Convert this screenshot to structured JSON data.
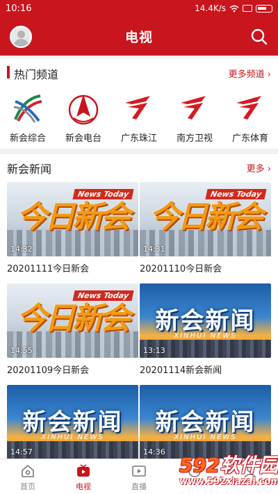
{
  "status_bar": {
    "time": "10:16",
    "network_speed": "14.4K/s"
  },
  "header": {
    "title": "电视",
    "avatar_icon": "avatar-icon",
    "search_icon": "search-icon"
  },
  "hot_channels": {
    "title": "热门频道",
    "more": "更多频道 ›",
    "items": [
      {
        "label": "新会综合",
        "icon": "xinhui-general-logo"
      },
      {
        "label": "新会电台",
        "icon": "xinhui-radio-logo"
      },
      {
        "label": "广东珠江",
        "icon": "guangdong-tv-logo"
      },
      {
        "label": "南方卫视",
        "icon": "guangdong-tv-logo"
      },
      {
        "label": "广东体育",
        "icon": "guangdong-tv-logo"
      }
    ]
  },
  "news": {
    "title": "新会新闻",
    "more": "更多 ›",
    "items": [
      {
        "title": "20201111今日新会",
        "duration": "14:32",
        "thumb": "today",
        "thumb_text": "今日新会",
        "thumb_tag": "News Today"
      },
      {
        "title": "20201110今日新会",
        "duration": "14:31",
        "thumb": "today",
        "thumb_text": "今日新会",
        "thumb_tag": "News Today"
      },
      {
        "title": "20201109今日新会",
        "duration": "14:55",
        "thumb": "today",
        "thumb_text": "今日新会",
        "thumb_tag": "News Today"
      },
      {
        "title": "20201114新会新闻",
        "duration": "13:13",
        "thumb": "xinhui",
        "thumb_text": "新会新闻",
        "thumb_sub": "XINHUI NEWS"
      },
      {
        "title": "",
        "duration": "14:57",
        "thumb": "xinhui",
        "thumb_text": "新会新闻",
        "thumb_sub": "XINHUI NEWS"
      },
      {
        "title": "",
        "duration": "14:36",
        "thumb": "xinhui",
        "thumb_text": "新会新闻",
        "thumb_sub": "XINHUI NEWS"
      }
    ]
  },
  "bottom_nav": {
    "items": [
      {
        "label": "首页",
        "icon": "home-icon",
        "active": false
      },
      {
        "label": "电视",
        "icon": "tv-icon",
        "active": true
      },
      {
        "label": "直播",
        "icon": "live-icon",
        "active": false
      },
      {
        "label": "",
        "icon": "radio-icon",
        "active": false
      },
      {
        "label": "",
        "icon": "user-icon",
        "active": false
      }
    ]
  },
  "watermark": {
    "brand_num": "592",
    "brand_text": "软件园",
    "url": "www.592xiazai.com"
  },
  "colors": {
    "accent": "#c9151e",
    "background": "#f2f2f2"
  }
}
